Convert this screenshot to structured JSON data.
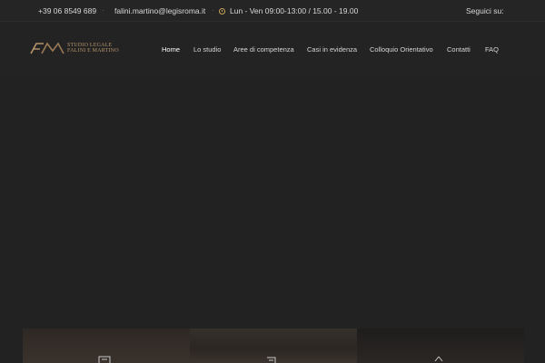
{
  "topbar": {
    "phone": "+39 06 8549 689",
    "email": "falini.martino@legisroma.it",
    "hours": "Lun - Ven 09:00-13:00 / 15.00 - 19.00",
    "social_label": "Seguici su:"
  },
  "logo": {
    "line1": "STUDIO LEGALE",
    "line2": "FALINI E MARTINO"
  },
  "nav": {
    "items": [
      {
        "label": "Home",
        "active": true
      },
      {
        "label": "Lo studio"
      },
      {
        "label": "Aree di competenza"
      },
      {
        "label": "Casi in evidenza"
      },
      {
        "label": "Colloquio Orientativo"
      },
      {
        "label": "Contatti"
      },
      {
        "label": "FAQ"
      }
    ]
  },
  "colors": {
    "accent": "#c9a35a",
    "logo": "#b8956a",
    "background": "#222222"
  },
  "cards": [
    {
      "icon": "document-icon"
    },
    {
      "icon": "scroll-icon"
    },
    {
      "icon": "scales-icon"
    }
  ]
}
